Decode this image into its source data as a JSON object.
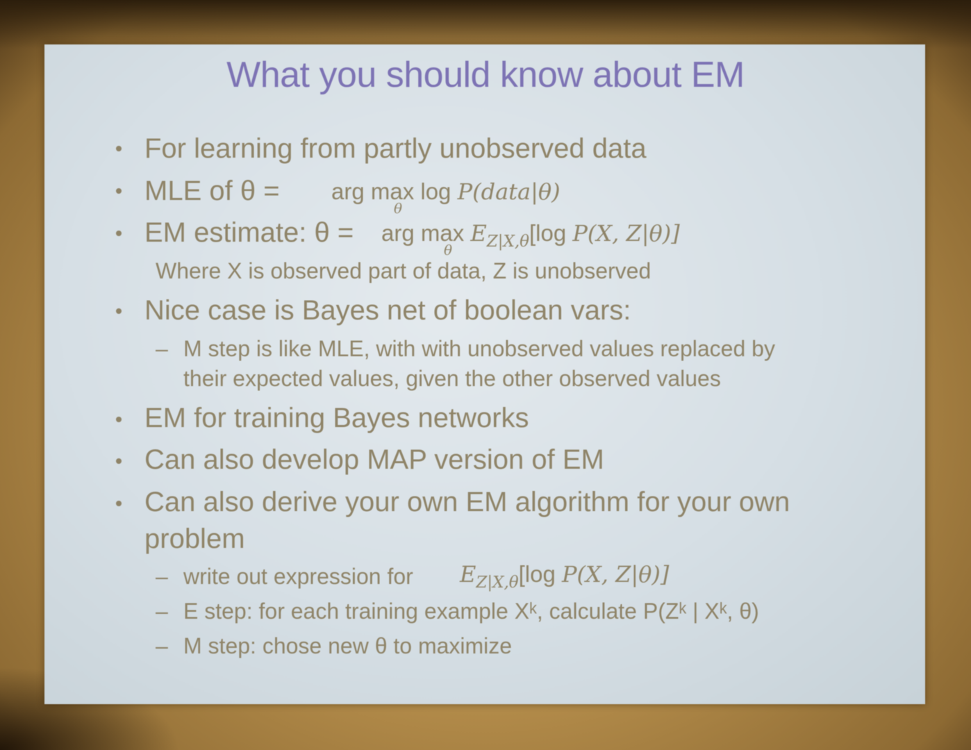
{
  "title": "What you should know about EM",
  "bullets": {
    "b1": "For learning from partly unobserved data",
    "b2_prefix": "MLE of θ =",
    "b2_math_pre": "arg max log ",
    "b2_math_expr": "P(data|θ)",
    "b3_prefix": "EM estimate: θ =",
    "b3_math_pre": "arg max ",
    "b3_E": "E",
    "b3_sub": "Z|X,θ",
    "b3_math_post_a": "[log ",
    "b3_math_post_b": "P(X, Z|θ)]",
    "b3_note": "Where X is observed part of data, Z is unobserved",
    "b4": "Nice case is Bayes net of boolean vars:",
    "b4_sub_line1": "M step is like MLE, with with unobserved values replaced by",
    "b4_sub_line2": "their expected values, given the other observed values",
    "b5": "EM for training Bayes networks",
    "b6": "Can also develop MAP version of EM",
    "b7_line1": "Can also derive your own EM algorithm for your own",
    "b7_line2": "problem",
    "b7_s1": "write out expression for",
    "b7_s1_E": "E",
    "b7_s1_sub": "Z|X,θ",
    "b7_s1_post_a": "[log ",
    "b7_s1_post_b": "P(X, Z|θ)]",
    "b7_s2": "E step: for each training example Xᵏ, calculate P(Zᵏ | Xᵏ, θ)",
    "b7_s3": "M step: chose new θ to maximize",
    "theta_under": "θ",
    "dash": "–"
  },
  "colors": {
    "title": "#7d73b4",
    "text": "#8f8468",
    "slide": "#dbe3e8"
  }
}
